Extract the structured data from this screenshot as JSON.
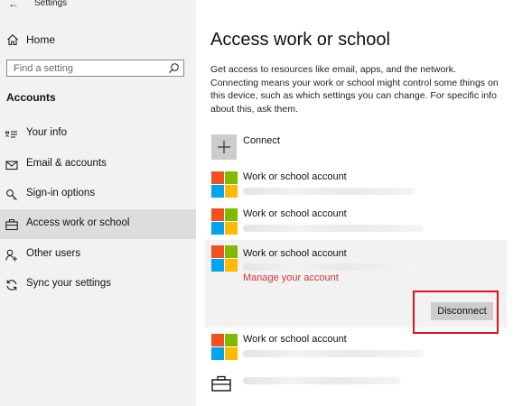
{
  "window": {
    "back_glyph": "←",
    "title": "Settings"
  },
  "sidebar": {
    "home_label": "Home",
    "search": {
      "placeholder": "Find a setting",
      "value": ""
    },
    "section_title": "Accounts",
    "items": [
      {
        "label": "Your info",
        "icon": "contact-card-icon",
        "active": false
      },
      {
        "label": "Email & accounts",
        "icon": "mail-icon",
        "active": false
      },
      {
        "label": "Sign-in options",
        "icon": "key-icon",
        "active": false
      },
      {
        "label": "Access work or school",
        "icon": "briefcase-icon",
        "active": true
      },
      {
        "label": "Other users",
        "icon": "person-add-icon",
        "active": false
      },
      {
        "label": "Sync your settings",
        "icon": "sync-icon",
        "active": false
      }
    ]
  },
  "main": {
    "title": "Access work or school",
    "description": "Get access to resources like email, apps, and the network. Connecting means your work or school might control some things on this device, such as which settings you can change. For specific info about this, ask them.",
    "connect_label": "Connect",
    "accounts": [
      {
        "name": "Work or school account"
      },
      {
        "name": "Work or school account"
      },
      {
        "name": "Work or school account",
        "expanded": true,
        "manage_link": "Manage your account",
        "disconnect_label": "Disconnect"
      },
      {
        "name": "Work or school account"
      }
    ]
  },
  "colors": {
    "sidebar_bg": "#f2f2f2",
    "active_item_bg": "#dddddd",
    "link_red": "#d13438",
    "highlight_red": "#e1101e",
    "ms_red": "#f25022",
    "ms_green": "#7fba00",
    "ms_blue": "#00a4ef",
    "ms_yellow": "#ffb900"
  }
}
